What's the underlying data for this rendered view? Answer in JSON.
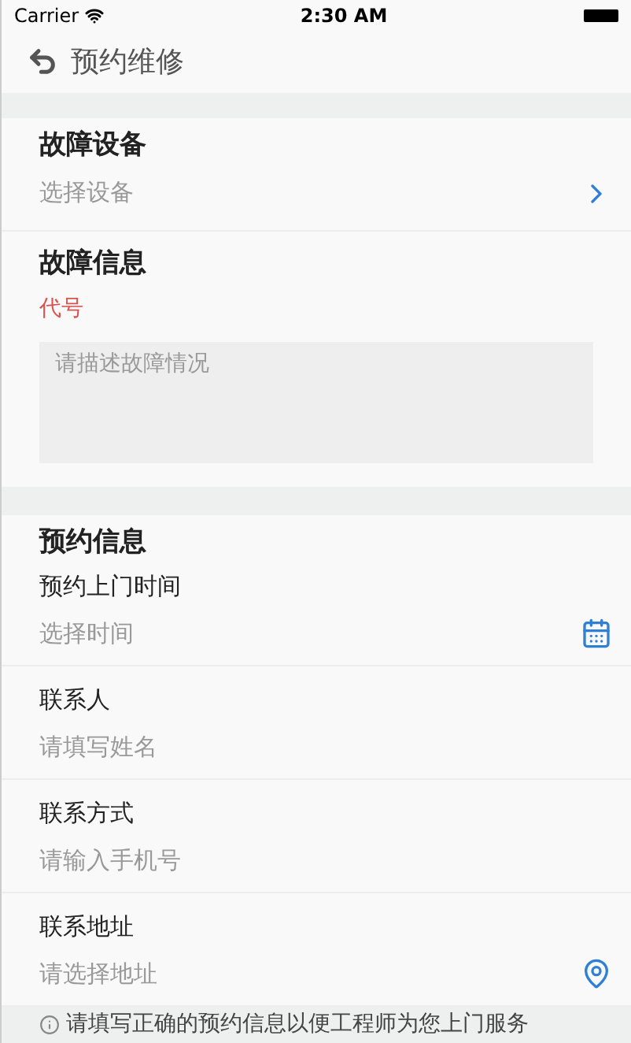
{
  "status_bar": {
    "carrier": "Carrier",
    "time": "2:30 AM"
  },
  "nav": {
    "title": "预约维修"
  },
  "device": {
    "title": "故障设备",
    "placeholder": "选择设备"
  },
  "fault": {
    "title": "故障信息",
    "code": "代号",
    "placeholder": "请描述故障情况"
  },
  "booking": {
    "title": "预约信息",
    "fields": [
      {
        "kind": "date",
        "label": "预约上门时间",
        "placeholder": "选择时间"
      },
      {
        "kind": "text",
        "label": "联系人",
        "placeholder": "请填写姓名"
      },
      {
        "kind": "text",
        "label": "联系方式",
        "placeholder": "请输入手机号"
      },
      {
        "kind": "location",
        "label": "联系地址",
        "placeholder": "请选择地址"
      }
    ]
  },
  "notice": "请填写正确的预约信息以便工程师为您上门服务"
}
